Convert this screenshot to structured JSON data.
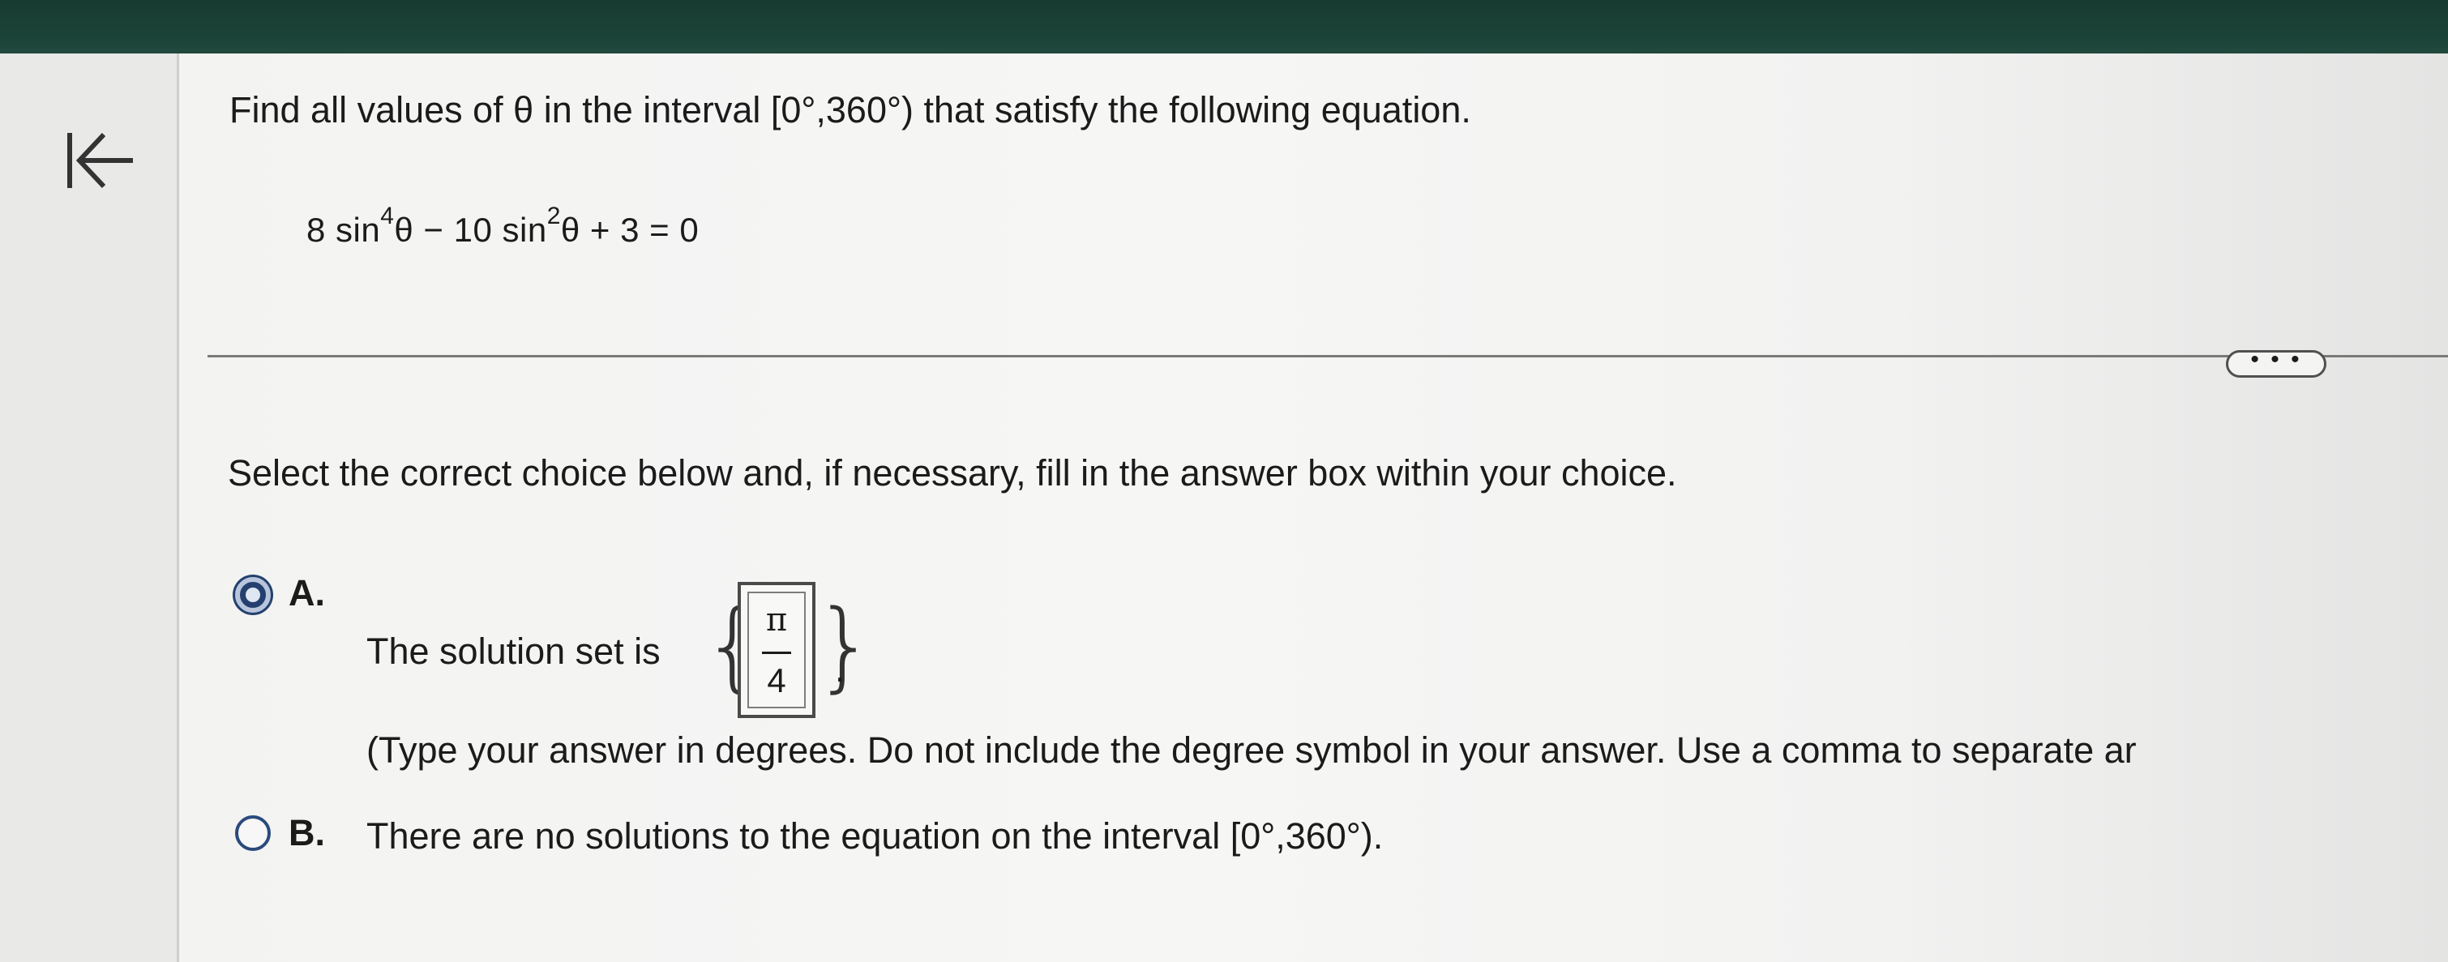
{
  "question": {
    "prompt": "Find all values of θ in the interval [0°,360°) that satisfy the following equation.",
    "equation": {
      "coef1": "8 sin",
      "exp1": "4",
      "term1_var": "θ − 10 sin",
      "exp2": "2",
      "rest": "θ + 3 = 0"
    }
  },
  "toolbar": {
    "more_label": "• • •"
  },
  "instruction": "Select the correct choice below and, if necessary, fill in the answer box within your choice.",
  "choices": {
    "a": {
      "letter": "A.",
      "selected": true,
      "text": "The solution set is",
      "open_brace": "{",
      "close_brace": "}",
      "answer_numerator": "π",
      "answer_denominator": "4",
      "period": ".",
      "hint": "(Type your answer in degrees. Do not include the degree symbol in your answer. Use a comma to separate ar"
    },
    "b": {
      "letter": "B.",
      "selected": false,
      "text": "There are no solutions to the equation on the interval [0°,360°)."
    }
  },
  "colors": {
    "radio_selected": "#24406e",
    "top_band": "#1c4438"
  },
  "icons": {
    "collapse": "collapse-left-arrow-icon"
  }
}
